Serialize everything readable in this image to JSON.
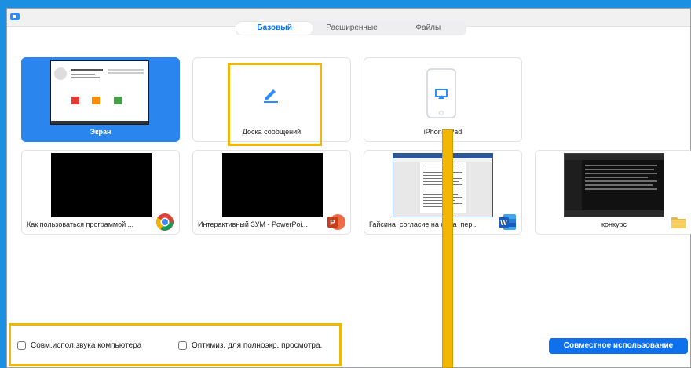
{
  "tabs": [
    {
      "label": "Базовый",
      "active": true
    },
    {
      "label": "Расширенные",
      "active": false
    },
    {
      "label": "Файлы",
      "active": false
    }
  ],
  "tiles": [
    {
      "label": "Экран",
      "icon": "screen",
      "selected": true
    },
    {
      "label": "Доска сообщений",
      "icon": "pencil-icon"
    },
    {
      "label": "iPhone/iPad",
      "icon": "airplay-icon"
    },
    {
      "label": "Как пользоваться программой ...",
      "icon": "chrome-icon"
    },
    {
      "label": "Интерактивный ЗУМ - PowerPoi...",
      "icon": "powerpoint-icon"
    },
    {
      "label": "Гайсина_согласие на обра_пер...",
      "icon": "word-icon"
    },
    {
      "label": "конкурс",
      "icon": "folder-icon"
    }
  ],
  "options": {
    "computer_sound": "Совм.испол.звука компьютера",
    "optimize_fullscreen": "Оптимиз. для полноэкр. просмотра."
  },
  "share_button": "Совместное использование",
  "colors": {
    "accent": "#0e71eb",
    "selected_tile": "#2a86ee",
    "highlight": "#f2b705",
    "desktop": "#1c8fe0"
  }
}
